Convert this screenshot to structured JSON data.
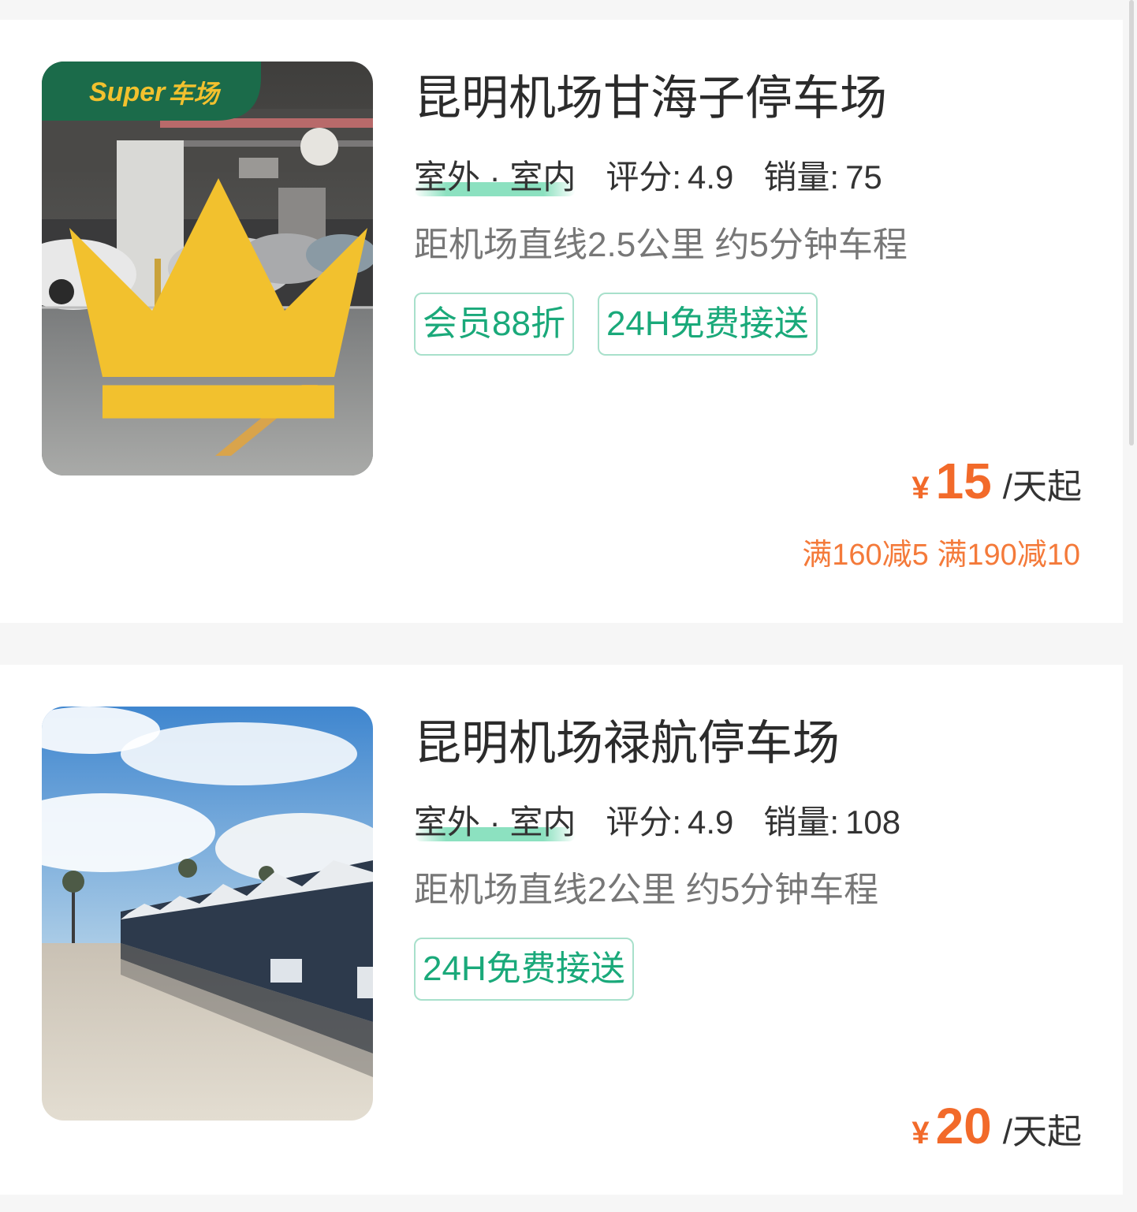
{
  "colors": {
    "accent_green": "#1aa97a",
    "price_orange": "#f26a2a",
    "page_bg": "#f6f6f6"
  },
  "listings": [
    {
      "badge_brand": "Super",
      "badge_suffix": "车场",
      "badge_icon": "crown-icon",
      "title": "昆明机场甘海子停车场",
      "env": "室外 · 室内",
      "rating_label": "评分:",
      "rating": "4.9",
      "sales_label": "销量:",
      "sales": "75",
      "distance": "距机场直线2.5公里 约5分钟车程",
      "tags": [
        "会员88折",
        "24H免费接送"
      ],
      "currency": "¥",
      "price": "15",
      "price_unit": "/天起",
      "promo": "满160减5 满190减10"
    },
    {
      "title": "昆明机场禄航停车场",
      "env": "室外 · 室内",
      "rating_label": "评分:",
      "rating": "4.9",
      "sales_label": "销量:",
      "sales": "108",
      "distance": "距机场直线2公里 约5分钟车程",
      "tags": [
        "24H免费接送"
      ],
      "currency": "¥",
      "price": "20",
      "price_unit": "/天起"
    }
  ]
}
